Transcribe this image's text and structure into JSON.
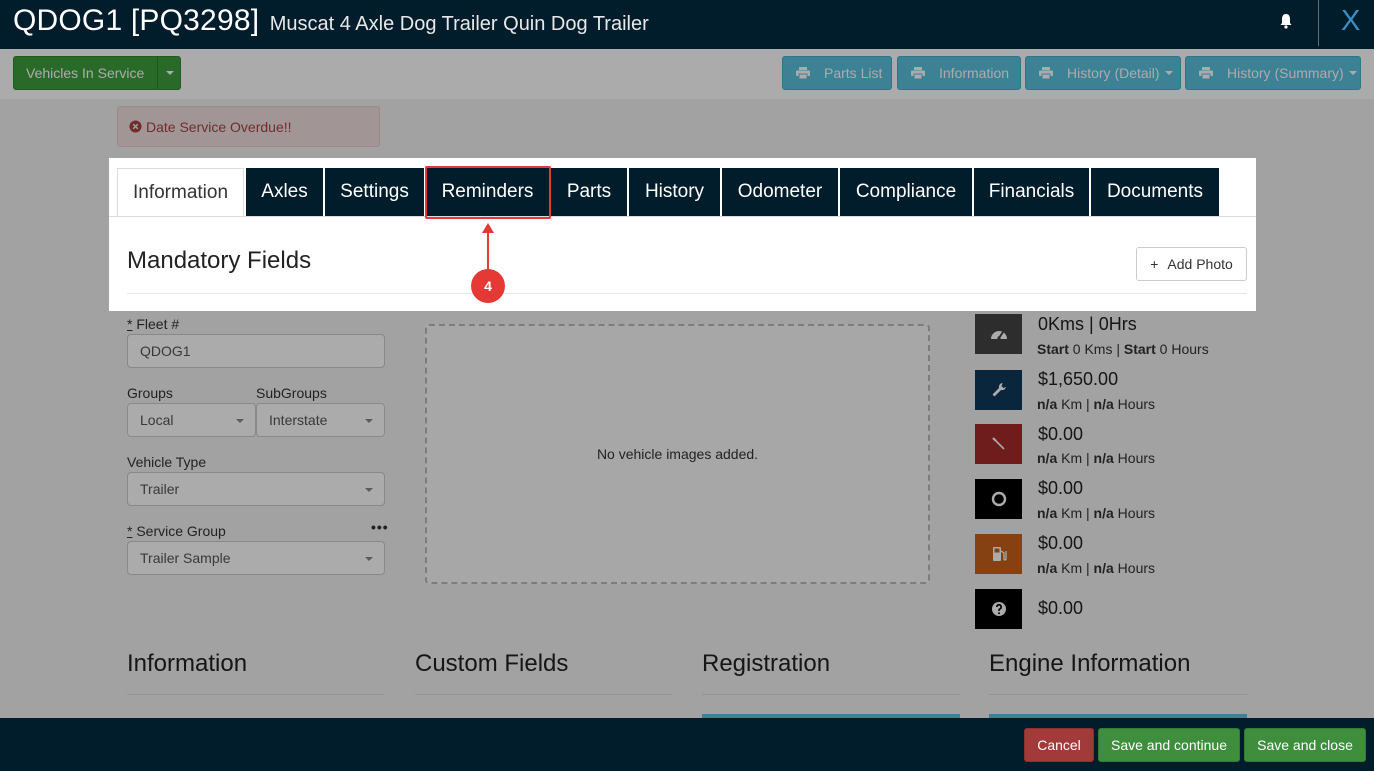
{
  "header": {
    "code": "QDOG1 [PQ3298]",
    "description": "Muscat 4 Axle Dog Trailer Quin Dog Trailer",
    "close_label": "X"
  },
  "toolbar": {
    "vehicles_in_service": "Vehicles In Service",
    "parts_list": "Parts List",
    "information": "Information",
    "history_detail": "History (Detail)",
    "history_summary": "History (Summary)"
  },
  "alert": {
    "text": "Date Service Overdue!!"
  },
  "tabs": [
    {
      "label": "Information",
      "active": true
    },
    {
      "label": "Axles"
    },
    {
      "label": "Settings"
    },
    {
      "label": "Reminders"
    },
    {
      "label": "Parts"
    },
    {
      "label": "History"
    },
    {
      "label": "Odometer"
    },
    {
      "label": "Compliance"
    },
    {
      "label": "Financials"
    },
    {
      "label": "Documents"
    }
  ],
  "mandatory": {
    "title": "Mandatory Fields",
    "add_photo": "Add Photo"
  },
  "form": {
    "fleet_label": "Fleet #",
    "fleet_value": "QDOG1",
    "groups_label": "Groups",
    "groups_value": "Local",
    "subgroups_label": "SubGroups",
    "subgroups_value": "Interstate",
    "vehicle_type_label": "Vehicle Type",
    "vehicle_type_value": "Trailer",
    "service_group_label": "Service Group",
    "service_group_value": "Trailer Sample",
    "required_mark": "*",
    "more": "•••"
  },
  "images": {
    "empty_text": "No vehicle images added."
  },
  "stats": [
    {
      "icon": "speedometer-icon",
      "color": "#444444",
      "value": "0Kms | 0Hrs",
      "sub": [
        "Start",
        " 0 Kms | ",
        "Start",
        " 0 Hours"
      ]
    },
    {
      "icon": "wrench-icon",
      "color": "#0e3a5b",
      "value": "$1,650.00",
      "sub": [
        "n/a",
        " Km | ",
        "n/a",
        " Hours"
      ]
    },
    {
      "icon": "screwdriver-icon",
      "color": "#a52a2a",
      "value": "$0.00",
      "sub": [
        "n/a",
        " Km | ",
        "n/a",
        " Hours"
      ]
    },
    {
      "icon": "tyre-icon",
      "color": "#000000",
      "value": "$0.00",
      "sub": [
        "n/a",
        " Km | ",
        "n/a",
        " Hours"
      ]
    },
    {
      "icon": "fuel-pump-icon",
      "color": "#c8621c",
      "value": "$0.00",
      "sub": [
        "n/a",
        " Km | ",
        "n/a",
        " Hours"
      ]
    },
    {
      "icon": "question-circle-icon",
      "color": "#000000",
      "value": "$0.00"
    }
  ],
  "sections": [
    "Information",
    "Custom Fields",
    "Registration",
    "Engine Information"
  ],
  "footer": {
    "cancel": "Cancel",
    "save_continue": "Save and continue",
    "save_close": "Save and close"
  },
  "annotation": {
    "step": "4"
  },
  "colors": {
    "navy": "#011c2b",
    "accent_blue": "#5bc0de",
    "green": "#3e9e3e",
    "annotation_red": "#e53935"
  }
}
